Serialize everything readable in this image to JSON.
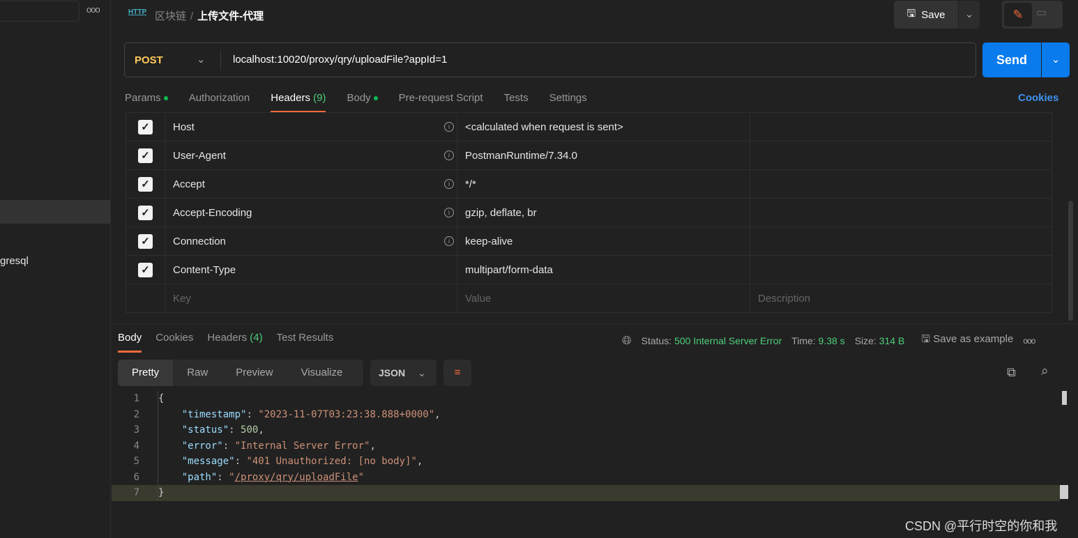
{
  "sidebar": {
    "more_icon": "ooo",
    "item_partial": "gresql"
  },
  "header": {
    "http_icon": "HTTP",
    "breadcrumb_parent": "区块链",
    "breadcrumb_sep": "/",
    "breadcrumb_current": "上传文件-代理",
    "save_label": "Save"
  },
  "request": {
    "method": "POST",
    "url": "localhost:10020/proxy/qry/uploadFile?appId=1",
    "send_label": "Send",
    "tabs": [
      {
        "label": "Params",
        "dot": true
      },
      {
        "label": "Authorization"
      },
      {
        "label": "Headers",
        "count": "(9)",
        "active": true
      },
      {
        "label": "Body",
        "dot": true
      },
      {
        "label": "Pre-request Script"
      },
      {
        "label": "Tests"
      },
      {
        "label": "Settings"
      }
    ],
    "cookies_label": "Cookies"
  },
  "headers_table": {
    "rows": [
      {
        "key": "Host",
        "value": "<calculated when request is sent>",
        "checked": true,
        "info": true
      },
      {
        "key": "User-Agent",
        "value": "PostmanRuntime/7.34.0",
        "checked": true,
        "info": true
      },
      {
        "key": "Accept",
        "value": "*/*",
        "checked": true,
        "info": true
      },
      {
        "key": "Accept-Encoding",
        "value": "gzip, deflate, br",
        "checked": true,
        "info": true
      },
      {
        "key": "Connection",
        "value": "keep-alive",
        "checked": true,
        "info": true
      },
      {
        "key": "Content-Type",
        "value": "multipart/form-data",
        "checked": true,
        "info": false
      }
    ],
    "placeholders": {
      "key": "Key",
      "value": "Value",
      "description": "Description"
    }
  },
  "response": {
    "tabs": [
      {
        "label": "Body",
        "active": true
      },
      {
        "label": "Cookies"
      },
      {
        "label": "Headers",
        "count": "(4)"
      },
      {
        "label": "Test Results"
      }
    ],
    "status_label": "Status:",
    "status": "500 Internal Server Error",
    "time_label": "Time:",
    "time": "9.38 s",
    "size_label": "Size:",
    "size": "314 B",
    "save_example": "Save as example",
    "more": "ooo",
    "views": [
      "Pretty",
      "Raw",
      "Preview",
      "Visualize"
    ],
    "format": "JSON",
    "code_lines": [
      "{",
      "    \"timestamp\": \"2023-11-07T03:23:38.888+0000\",",
      "    \"status\": 500,",
      "    \"error\": \"Internal Server Error\",",
      "    \"message\": \"401 Unauthorized: [no body]\",",
      "    \"path\": \"/proxy/qry/uploadFile\"",
      "}"
    ]
  },
  "watermark": "CSDN @平行时空的你和我",
  "colors": {
    "accent": "#f26b3a",
    "send": "#097bed",
    "method": "#ffca5a",
    "status_ok": "#4fce7a"
  }
}
